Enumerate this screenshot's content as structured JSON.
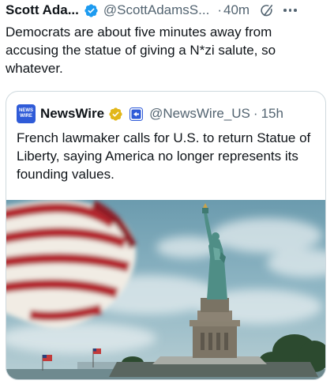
{
  "tweet": {
    "author_name": "Scott Ada...",
    "handle": "@ScottAdamsS...",
    "separator": "·",
    "time": "40m",
    "text": "Democrats are about five minutes away from accusing the statue of giving a N*zi salute, so whatever.",
    "icons": [
      "verified-badge-icon",
      "grok-icon",
      "more-options-icon"
    ],
    "colors": {
      "verified": "#1d9bf0",
      "muted": "#536471",
      "text": "#0f1419"
    }
  },
  "quote": {
    "avatar_text_line1": "NEWS",
    "avatar_text_line2": "WIRE",
    "author_name": "NewsWire",
    "handle": "@NewsWire_US",
    "separator": "·",
    "time": "15h",
    "text": "French lawmaker calls for U.S. to return Statue of Liberty, saying America no longer represents its founding values.",
    "icons": [
      "gold-verified-badge-icon",
      "affiliate-badge-icon"
    ],
    "colors": {
      "avatar": "#2f5bd8",
      "gold_badge": "#e2b719",
      "border": "#cfd9de"
    }
  }
}
